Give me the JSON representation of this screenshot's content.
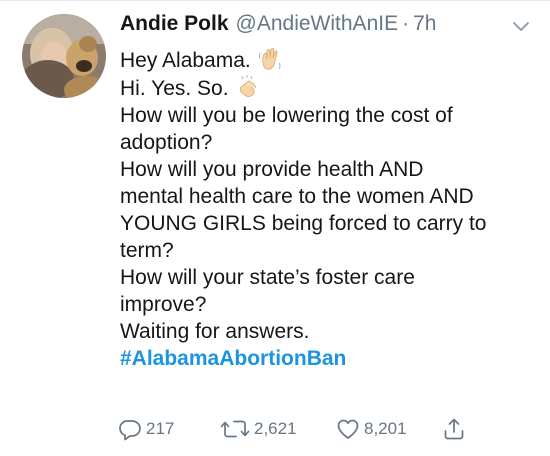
{
  "tweet": {
    "display_name": "Andie Polk",
    "handle": "@AndieWithAnIE",
    "separator": "·",
    "time": "7h",
    "avatar_icon": "profile-photo-with-dog",
    "menu_icon": "chevron-down-icon",
    "lines": [
      "Hey Alabama.",
      "Hi. Yes. So.",
      "How will you be lowering the cost of",
      "adoption?",
      "How will you provide health AND",
      "mental health care to the women AND",
      "YOUNG GIRLS being forced to carry to",
      "term?",
      "How will your state’s foster care",
      "improve?",
      "Waiting for answers."
    ],
    "emojis": [
      "waving-hand-emoji",
      "clapping-hands-emoji"
    ],
    "hashtag": "#AlabamaAbortionBan"
  },
  "actions": {
    "reply_count": "217",
    "retweet_count": "2,621",
    "like_count": "8,201",
    "icons": [
      "reply-icon",
      "retweet-icon",
      "like-icon",
      "share-icon"
    ]
  },
  "colors": {
    "text": "#14171a",
    "secondary": "#657786",
    "link": "#1b95e0"
  }
}
